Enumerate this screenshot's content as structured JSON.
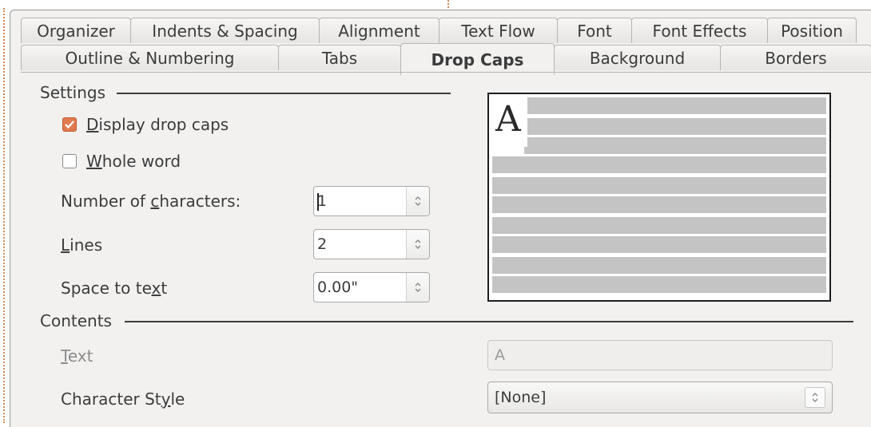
{
  "tabs_row1": [
    {
      "label": "Organizer"
    },
    {
      "label": "Indents & Spacing"
    },
    {
      "label": "Alignment"
    },
    {
      "label": "Text Flow"
    },
    {
      "label": "Font"
    },
    {
      "label": "Font Effects"
    },
    {
      "label": "Position"
    }
  ],
  "tabs_row2": [
    {
      "label": "Outline & Numbering"
    },
    {
      "label": "Tabs"
    },
    {
      "label": "Drop Caps",
      "active": true
    },
    {
      "label": "Background"
    },
    {
      "label": "Borders"
    }
  ],
  "settings": {
    "heading": "Settings",
    "display_drop_caps": {
      "pre": "",
      "key": "D",
      "post": "isplay drop caps",
      "checked": true
    },
    "whole_word": {
      "pre": "",
      "key": "W",
      "post": "hole word",
      "checked": false
    },
    "num_chars": {
      "pre": "Number of ",
      "key": "c",
      "post": "haracters:",
      "value": "1"
    },
    "lines": {
      "pre": "",
      "key": "L",
      "post": "ines",
      "value": "2"
    },
    "space": {
      "pre": "Space to te",
      "key": "x",
      "post": "t",
      "value": "0.00\""
    }
  },
  "preview": {
    "drop_letter": "A"
  },
  "contents": {
    "heading": "Contents",
    "text": {
      "pre": "",
      "key": "T",
      "post": "ext",
      "value": "A"
    },
    "char_style": {
      "pre": "Character St",
      "key": "y",
      "post": "le",
      "value": "[None]"
    }
  },
  "colors": {
    "accent": "#e07a4f",
    "dialog_bg": "#f2f1f0"
  },
  "icons": {
    "spin": "spin-arrows-icon",
    "check": "checkmark-icon"
  }
}
